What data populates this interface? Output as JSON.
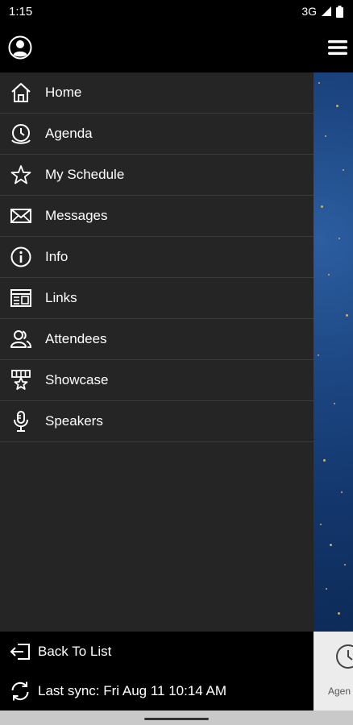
{
  "status_bar": {
    "time": "1:15",
    "network": "3G"
  },
  "drawer": {
    "items": [
      {
        "label": "Home",
        "icon": "home-icon"
      },
      {
        "label": "Agenda",
        "icon": "clock-icon"
      },
      {
        "label": "My Schedule",
        "icon": "star-icon"
      },
      {
        "label": "Messages",
        "icon": "envelope-icon"
      },
      {
        "label": "Info",
        "icon": "info-icon"
      },
      {
        "label": "Links",
        "icon": "links-icon"
      },
      {
        "label": "Attendees",
        "icon": "attendees-icon"
      },
      {
        "label": "Showcase",
        "icon": "showcase-icon"
      },
      {
        "label": "Speakers",
        "icon": "microphone-icon"
      }
    ],
    "footer": {
      "back_label": "Back To List",
      "sync_label": "Last sync: Fri Aug 11 10:14 AM"
    }
  },
  "background": {
    "tab_label": "Agen"
  },
  "colors": {
    "drawer_bg": "#252525",
    "header_bg": "#000000",
    "accent_blue": "#1c4682",
    "gold": "#d6ab5c"
  }
}
